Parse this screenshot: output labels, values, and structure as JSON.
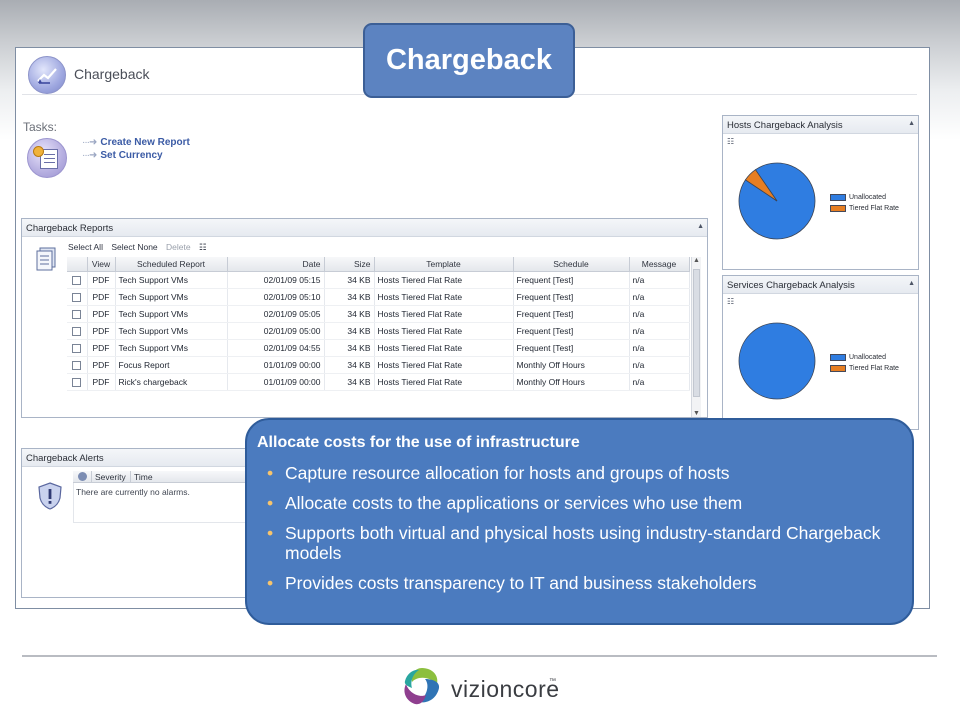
{
  "slide": {
    "title": "Chargeback",
    "brand": {
      "name": "vizioncore",
      "trademark": "™"
    }
  },
  "app": {
    "header_title": "Chargeback",
    "tasks_label": "Tasks:",
    "tasks": [
      "Create New Report",
      "Set Currency"
    ]
  },
  "reports": {
    "panel_title": "Chargeback Reports",
    "toolbar": {
      "select_all": "Select All",
      "select_none": "Select None",
      "delete": "Delete"
    },
    "columns": [
      "View",
      "Scheduled Report",
      "Date",
      "Size",
      "Template",
      "Schedule",
      "Message"
    ],
    "rows": [
      [
        "PDF",
        "Tech Support VMs",
        "02/01/09 05:15",
        "34 KB",
        "Hosts Tiered Flat Rate",
        "Frequent [Test]",
        "n/a"
      ],
      [
        "PDF",
        "Tech Support VMs",
        "02/01/09 05:10",
        "34 KB",
        "Hosts Tiered Flat Rate",
        "Frequent [Test]",
        "n/a"
      ],
      [
        "PDF",
        "Tech Support VMs",
        "02/01/09 05:05",
        "34 KB",
        "Hosts Tiered Flat Rate",
        "Frequent [Test]",
        "n/a"
      ],
      [
        "PDF",
        "Tech Support VMs",
        "02/01/09 05:00",
        "34 KB",
        "Hosts Tiered Flat Rate",
        "Frequent [Test]",
        "n/a"
      ],
      [
        "PDF",
        "Tech Support VMs",
        "02/01/09 04:55",
        "34 KB",
        "Hosts Tiered Flat Rate",
        "Frequent [Test]",
        "n/a"
      ],
      [
        "PDF",
        "Focus Report",
        "01/01/09 00:00",
        "34 KB",
        "Hosts Tiered Flat Rate",
        "Monthly Off Hours",
        "n/a"
      ],
      [
        "PDF",
        "Rick's chargeback",
        "01/01/09 00:00",
        "34 KB",
        "Hosts Tiered Flat Rate",
        "Monthly Off Hours",
        "n/a"
      ]
    ]
  },
  "alerts": {
    "panel_title": "Chargeback Alerts",
    "columns": {
      "severity": "Severity",
      "time": "Time"
    },
    "empty_message": "There are currently no alarms."
  },
  "hosts_analysis": {
    "panel_title": "Hosts Chargeback Analysis",
    "legend": [
      "Unallocated",
      "Tiered Flat Rate"
    ]
  },
  "services_analysis": {
    "panel_title": "Services Chargeback Analysis",
    "legend": [
      "Unallocated",
      "Tiered Flat Rate"
    ]
  },
  "chart_data": [
    {
      "type": "pie",
      "title": "Hosts Chargeback Analysis",
      "categories": [
        "Unallocated",
        "Tiered Flat Rate"
      ],
      "values": [
        94,
        6
      ],
      "colors": [
        "#2f7de1",
        "#e67e22"
      ]
    },
    {
      "type": "pie",
      "title": "Services Chargeback Analysis",
      "categories": [
        "Unallocated",
        "Tiered Flat Rate"
      ],
      "values": [
        100,
        0
      ],
      "colors": [
        "#2f7de1",
        "#e67e22"
      ]
    }
  ],
  "callout": {
    "heading": "Allocate costs for the use of infrastructure",
    "bullets": [
      "Capture resource allocation for hosts and groups of hosts",
      "Allocate costs to the applications or services who use them",
      "Supports both virtual and physical hosts using industry-standard Chargeback models",
      "Provides costs transparency to IT and business stakeholders"
    ]
  },
  "colors": {
    "callout_fill": "#4b7bbf",
    "title_fill": "#5c83c1",
    "bullet": "#f7c46c",
    "link": "#3b5ba5"
  }
}
